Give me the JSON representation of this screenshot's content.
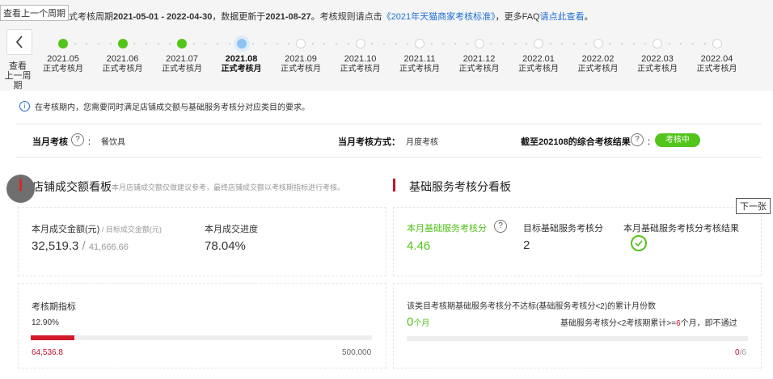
{
  "header": {
    "prev_period_tip": "查看上一个周期",
    "info_prefix": "正式考核周期",
    "period": "2021-05-01 - 2022-04-30",
    "info_mid": "，数据更新于",
    "update_date": "2021-08-27",
    "info_mid2": "。考核规则请点击",
    "rules_link": "《2021年天猫商家考核标准》",
    "info_mid3": "，更多FAQ",
    "faq_link": "请点此查看",
    "info_end": "。",
    "back_label_1": "查看",
    "back_label_2": "上一周期"
  },
  "timeline": {
    "sub_label": "正式考核月",
    "months": [
      {
        "label": "2021.05",
        "status": "done"
      },
      {
        "label": "2021.06",
        "status": "done"
      },
      {
        "label": "2021.07",
        "status": "done"
      },
      {
        "label": "2021.08",
        "status": "current"
      },
      {
        "label": "2021.09",
        "status": "future"
      },
      {
        "label": "2021.10",
        "status": "future"
      },
      {
        "label": "2021.11",
        "status": "future"
      },
      {
        "label": "2021.12",
        "status": "future"
      },
      {
        "label": "2022.01",
        "status": "future"
      },
      {
        "label": "2022.02",
        "status": "future"
      },
      {
        "label": "2022.03",
        "status": "future"
      },
      {
        "label": "2022.04",
        "status": "future"
      }
    ]
  },
  "notice": "在考核期内，您需要同时满足店铺成交额与基础服务考核分对应类目的要求。",
  "status_bar": {
    "month_assess_label": "当月考核",
    "colon": "：",
    "category": "餐饮具",
    "method_label": "当月考核方式：",
    "method_value": "月度考核",
    "result_label": "截至202108的综合考核结果",
    "result_badge": "考核中",
    "q_mark": "?"
  },
  "left_section": {
    "title": "店铺成交额看板",
    "desc": "本月店铺成交额仅做建议参考，最终店铺成交额以考核期指标进行考核。",
    "kpi1_label": "本月成交金额(元)",
    "kpi1_label_sep": " / ",
    "kpi1_label_target": "目标成交金额(元)",
    "kpi1_value": "32,519.3",
    "kpi1_sep": " / ",
    "kpi1_target": "41,666.66",
    "kpi2_label": "本月成交进度",
    "kpi2_value": "78.04%",
    "period_metric_label": "考核期指标",
    "period_pct": "12.90%",
    "period_progress": 0.129,
    "period_current": "64,536.8",
    "period_target": "500,000"
  },
  "right_section": {
    "title": "基础服务考核分看板",
    "score_label": "本月基础服务考核分",
    "score_value": "4.46",
    "target_label": "目标基础服务考核分",
    "target_value": "2",
    "result_label": "本月基础服务考核分考核结果",
    "fail_label": "该类目考核期基础服务考核分不达标(基础服务考核分<2)的累计月份数",
    "fail_count": "0",
    "fail_unit": "个月",
    "rule_text_a": "基础服务考核分<2考核期累计>=",
    "rule_num": "6",
    "rule_text_b": "个月，即不通过",
    "ratio_current": "0",
    "ratio_total": "/6"
  },
  "nav": {
    "next_tip": "下一张"
  },
  "colors": {
    "accent_green": "#52c41a",
    "accent_red": "#c41230",
    "link_blue": "#1f6fd6"
  }
}
